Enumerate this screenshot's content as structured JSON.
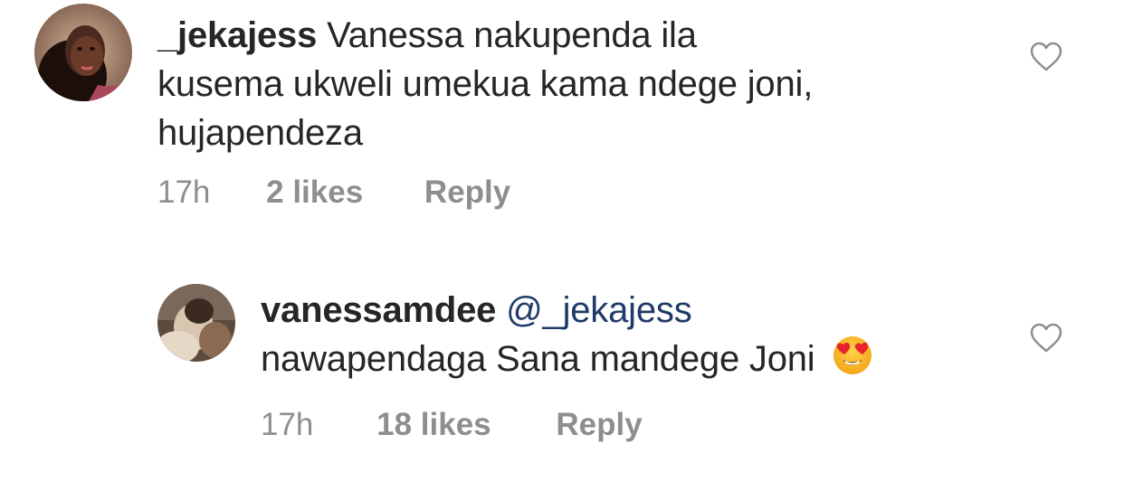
{
  "comments": [
    {
      "username": "_jekajess",
      "mention": "",
      "text_line1": "Vanessa nakupenda ila",
      "text_line2": "kusema ukweli umekua kama ndege joni,",
      "text_line3": "hujapendeza",
      "time": "17h",
      "likes": "2 likes",
      "reply": "Reply",
      "avatar_icon": "profile-photo",
      "like_icon": "heart-outline-icon"
    },
    {
      "username": "vanessamdee",
      "mention": "@_jekajess",
      "text_line1": "nawapendaga Sana mandege Joni",
      "emoji_icon": "smiling-face-with-heart-eyes-icon",
      "time": "17h",
      "likes": "18 likes",
      "reply": "Reply",
      "avatar_icon": "profile-photo",
      "like_icon": "heart-outline-icon"
    }
  ],
  "colors": {
    "text": "#262626",
    "meta": "#8e8e8e",
    "mention": "#1f3a68",
    "heart_stroke": "#8e8e8e"
  }
}
